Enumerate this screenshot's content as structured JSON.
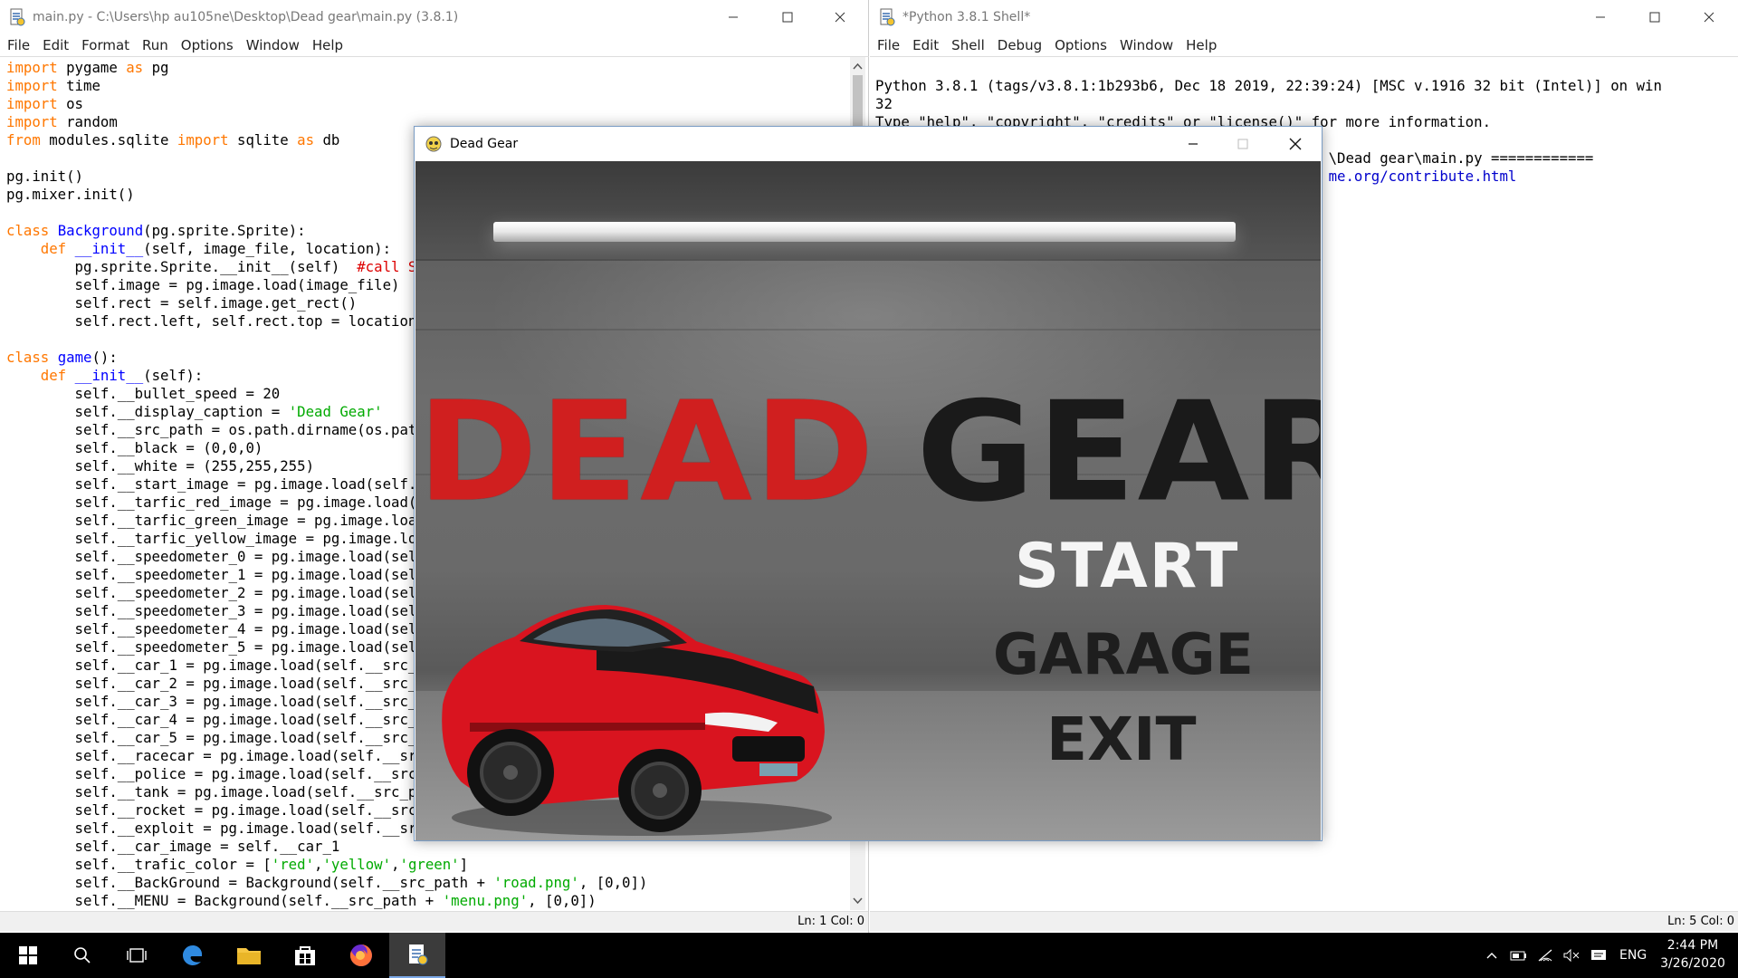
{
  "editor": {
    "title": "main.py - C:\\Users\\hp au105ne\\Desktop\\Dead gear\\main.py (3.8.1)",
    "menu": [
      "File",
      "Edit",
      "Format",
      "Run",
      "Options",
      "Window",
      "Help"
    ],
    "status": "Ln: 1  Col: 0"
  },
  "shell": {
    "title": "*Python 3.8.1 Shell*",
    "menu": [
      "File",
      "Edit",
      "Shell",
      "Debug",
      "Options",
      "Window",
      "Help"
    ],
    "lines": [
      "Python 3.8.1 (tags/v3.8.1:1b293b6, Dec 18 2019, 22:39:24) [MSC v.1916 32 bit (Intel)] on win",
      "32",
      "Type \"help\", \"copyright\", \"credits\" or \"license()\" for more information.",
      ">>> ",
      "",
      "                                                     \\Dead gear\\main.py ============",
      "",
      "                                                     me.org/contribute.html"
    ],
    "status": "Ln: 5  Col: 0"
  },
  "game": {
    "title": "Dead Gear",
    "logo_left": "DEAD",
    "logo_right": "GEAR",
    "menu": {
      "start": "START",
      "garage": "GARAGE",
      "exit": "EXIT"
    }
  },
  "taskbar": {
    "lang": "ENG",
    "time": "2:44 PM",
    "date": "3/26/2020"
  },
  "colors": {
    "keyword": "#ff7700",
    "builtin": "#0000ff",
    "string": "#00aa00",
    "comment": "#dd0000"
  }
}
